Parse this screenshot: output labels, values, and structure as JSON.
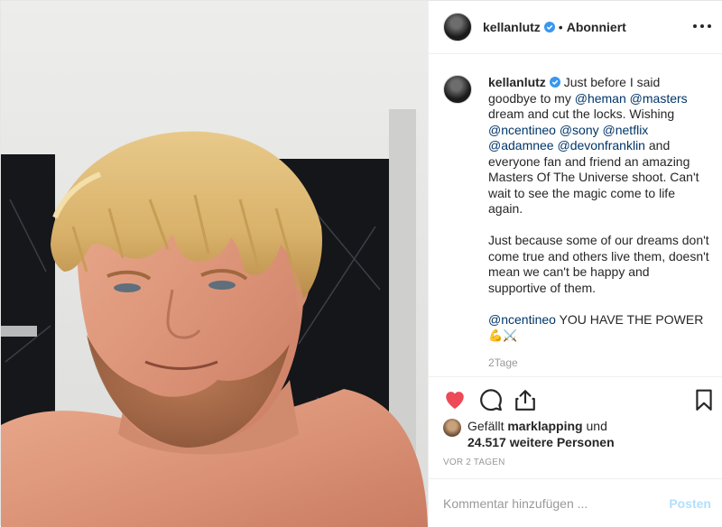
{
  "post": {
    "author": "kellanlutz",
    "follow_separator": "•",
    "follow_state": "Abonniert",
    "caption": {
      "line1": "Just before I said goodbye to my ",
      "m_heman": "@heman",
      "m_masters": "@masters",
      "line2": " dream and cut the locks. Wishing ",
      "m_ncentineo": "@ncentineo",
      "m_sony": "@sony",
      "m_netflix": "@netflix",
      "m_adamnee": "@adamnee",
      "m_devonfranklin": "@devonfranklin",
      "line3": " and everyone fan and friend an amazing Masters Of The Universe shoot. Can't wait to see the magic come to life again.",
      "para2": "Just because some of our dreams don't come true and others live them, doesn't mean we can't be happy and supportive of them.",
      "m_ncentineo2": "@ncentineo",
      "power": " YOU HAVE THE POWER",
      "emojis": "💪⚔️"
    },
    "caption_age": "2Tage",
    "likes": {
      "prefix": "Gefällt",
      "user": "marklapping",
      "suffix": "und",
      "count_line": "24.517 weitere Personen"
    },
    "timestamp": "VOR 2 TAGEN",
    "comment": {
      "placeholder": "Kommentar hinzufügen ...",
      "value": "",
      "post_label": "Posten"
    }
  },
  "icons": {
    "like": "heart-icon",
    "comment": "comment-icon",
    "share": "share-icon",
    "save": "bookmark-icon",
    "more": "more-options-icon",
    "verified": "verified-badge-icon"
  },
  "colors": {
    "heart": "#ed4956",
    "verified": "#3897f0",
    "mention": "#003569",
    "post_button_disabled": "#b2dffc",
    "muted_text": "#999999"
  }
}
